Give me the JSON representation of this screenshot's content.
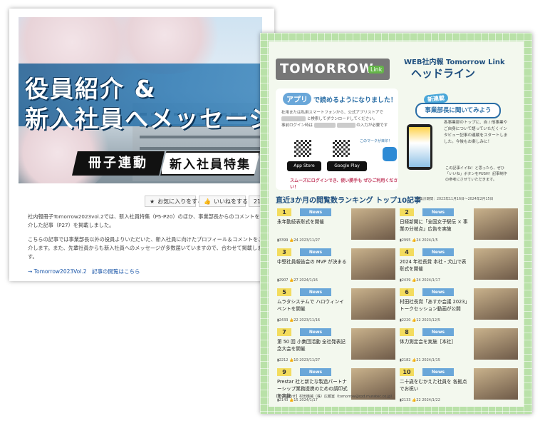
{
  "article": {
    "hero_line1": "役員紹介 &",
    "hero_line2": "新入社員へメッセージ",
    "tag_dark": "冊子連動",
    "tag_light": "新入社員特集",
    "buttons": {
      "bookmark": "お気に入りをする",
      "like": "いいねをする",
      "like_count": "21"
    },
    "paragraph1": "社内報冊子Tomorrow2023vol.2では、新入社員特集（P5-P20）のほか、事業部長からのコメントをご紹介した記事（P27）を掲載しました。",
    "paragraph2": "こちらの記事では事業部長以外の役員よりいただいた、新入社員に向けたプロフィール＆コメントをご紹介します。また、先輩社員からも新入社員へのメッセージが多数届いていますので、合わせて掲載します。",
    "link": "→ Tomorrow2023Vol.2　記事の閲覧はこちら"
  },
  "newsletter": {
    "logo": "TOMORROW",
    "logo_sub": "Link",
    "headline_small": "WEB社内報 Tomorrow Link",
    "headline_main": "ヘッドライン",
    "app": {
      "title_badge": "アプリ",
      "title_rest": "で読めるようになりました！",
      "text1": "社用または私用スマートフォンから、公式アプリストアで",
      "text2": "と検索してダウンロードしてください。",
      "text3": "事前ログイン時は",
      "text4": "の入力が必要です",
      "qr_label": "このマークが目印！",
      "appstore": "App Store",
      "googleplay": "Google Play",
      "note": "スムーズにログインでき、使い勝手も ぜひご利用ください！"
    },
    "serial": {
      "tag": "新連載",
      "title": "事業部長に聞いてみよう",
      "text": "各事業部のトップに、自 / 他事業やご自身について語っていただくインタビュー記事の連載をスタートしました。今後もお楽しみに！",
      "note": "この記事イイね！と思ったら、ぜひ「いいね」ボタンをPUSH！記事制作の参考にさせていただきます。"
    },
    "ranking": {
      "title": "直近3か月の閲覧数ランキング トップ10記事",
      "period": "※集計期間：2023年11月16日〜2024年2月15日",
      "tag": "News",
      "items": [
        {
          "num": "1",
          "title": "永年勤続表彰式を開催",
          "views": "3399",
          "likes": "24",
          "date": "2023/11/27"
        },
        {
          "num": "2",
          "title": "日経新聞に「全国女子駅伝 × 事業の分岐点」広告を実施",
          "views": "2995",
          "likes": "24",
          "date": "2024/1/5"
        },
        {
          "num": "3",
          "title": "中堅社員報告会の MVP が決まる",
          "views": "2907",
          "likes": "27",
          "date": "2024/1/16"
        },
        {
          "num": "4",
          "title": "2024 年社長賞 本社・犬山で表彰式を開催",
          "views": "2439",
          "likes": "24",
          "date": "2024/1/17"
        },
        {
          "num": "5",
          "title": "ムラタシステムで ハロウィンイベントを開催",
          "views": "2433",
          "likes": "22",
          "date": "2023/11/16"
        },
        {
          "num": "6",
          "title": "村田社長賞「あすか会議 2023」トークセッション動画が公開",
          "views": "2220",
          "likes": "12",
          "date": "2023/12/5"
        },
        {
          "num": "7",
          "title": "第 50 回 小集団活動 全社発表記念大会を開催",
          "views": "2212",
          "likes": "10",
          "date": "2023/11/27"
        },
        {
          "num": "8",
          "title": "体力測定会を実施［本社］",
          "views": "2182",
          "likes": "21",
          "date": "2024/1/15"
        },
        {
          "num": "9",
          "title": "Prestar 社と新たな製造パートナーシップ業務提携のための調印式を実施",
          "views": "2143",
          "likes": "15",
          "date": "2024/1/17"
        },
        {
          "num": "10",
          "title": "二十歳をむかえた社員を 各拠点でお祝い",
          "views": "2133",
          "likes": "22",
          "date": "2024/1/22"
        }
      ]
    },
    "contact": "【問い合わせ】村田機械（株）広報室（tomorrow@rpd.muratec.co.jp）"
  }
}
